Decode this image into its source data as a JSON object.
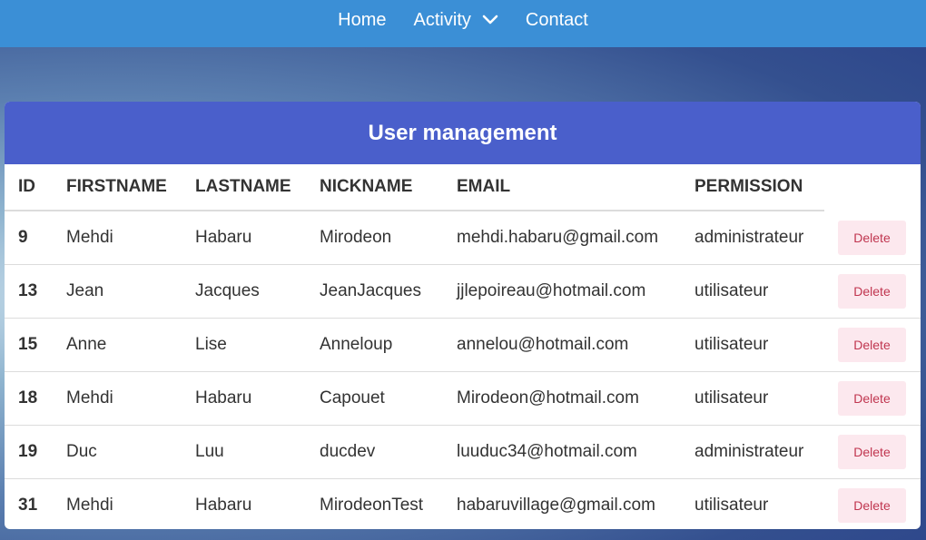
{
  "nav": {
    "items": [
      {
        "label": "Home"
      },
      {
        "label": "Activity"
      },
      {
        "label": "Contact"
      }
    ]
  },
  "card": {
    "title": "User management"
  },
  "table": {
    "columns": [
      "ID",
      "FIRSTNAME",
      "LASTNAME",
      "NICKNAME",
      "EMAIL",
      "PERMISSION"
    ],
    "delete_label": "Delete",
    "rows": [
      {
        "id": "9",
        "firstname": "Mehdi",
        "lastname": "Habaru",
        "nickname": "Mirodeon",
        "email": "mehdi.habaru@gmail.com",
        "permission": "administrateur"
      },
      {
        "id": "13",
        "firstname": "Jean",
        "lastname": "Jacques",
        "nickname": "JeanJacques",
        "email": "jjlepoireau@hotmail.com",
        "permission": "utilisateur"
      },
      {
        "id": "15",
        "firstname": "Anne",
        "lastname": "Lise",
        "nickname": "Anneloup",
        "email": "annelou@hotmail.com",
        "permission": "utilisateur"
      },
      {
        "id": "18",
        "firstname": "Mehdi",
        "lastname": "Habaru",
        "nickname": "Capouet",
        "email": "Mirodeon@hotmail.com",
        "permission": "utilisateur"
      },
      {
        "id": "19",
        "firstname": "Duc",
        "lastname": "Luu",
        "nickname": "ducdev",
        "email": "luuduc34@hotmail.com",
        "permission": "administrateur"
      },
      {
        "id": "31",
        "firstname": "Mehdi",
        "lastname": "Habaru",
        "nickname": "MirodeonTest",
        "email": "habaruvillage@gmail.com",
        "permission": "utilisateur"
      }
    ]
  }
}
